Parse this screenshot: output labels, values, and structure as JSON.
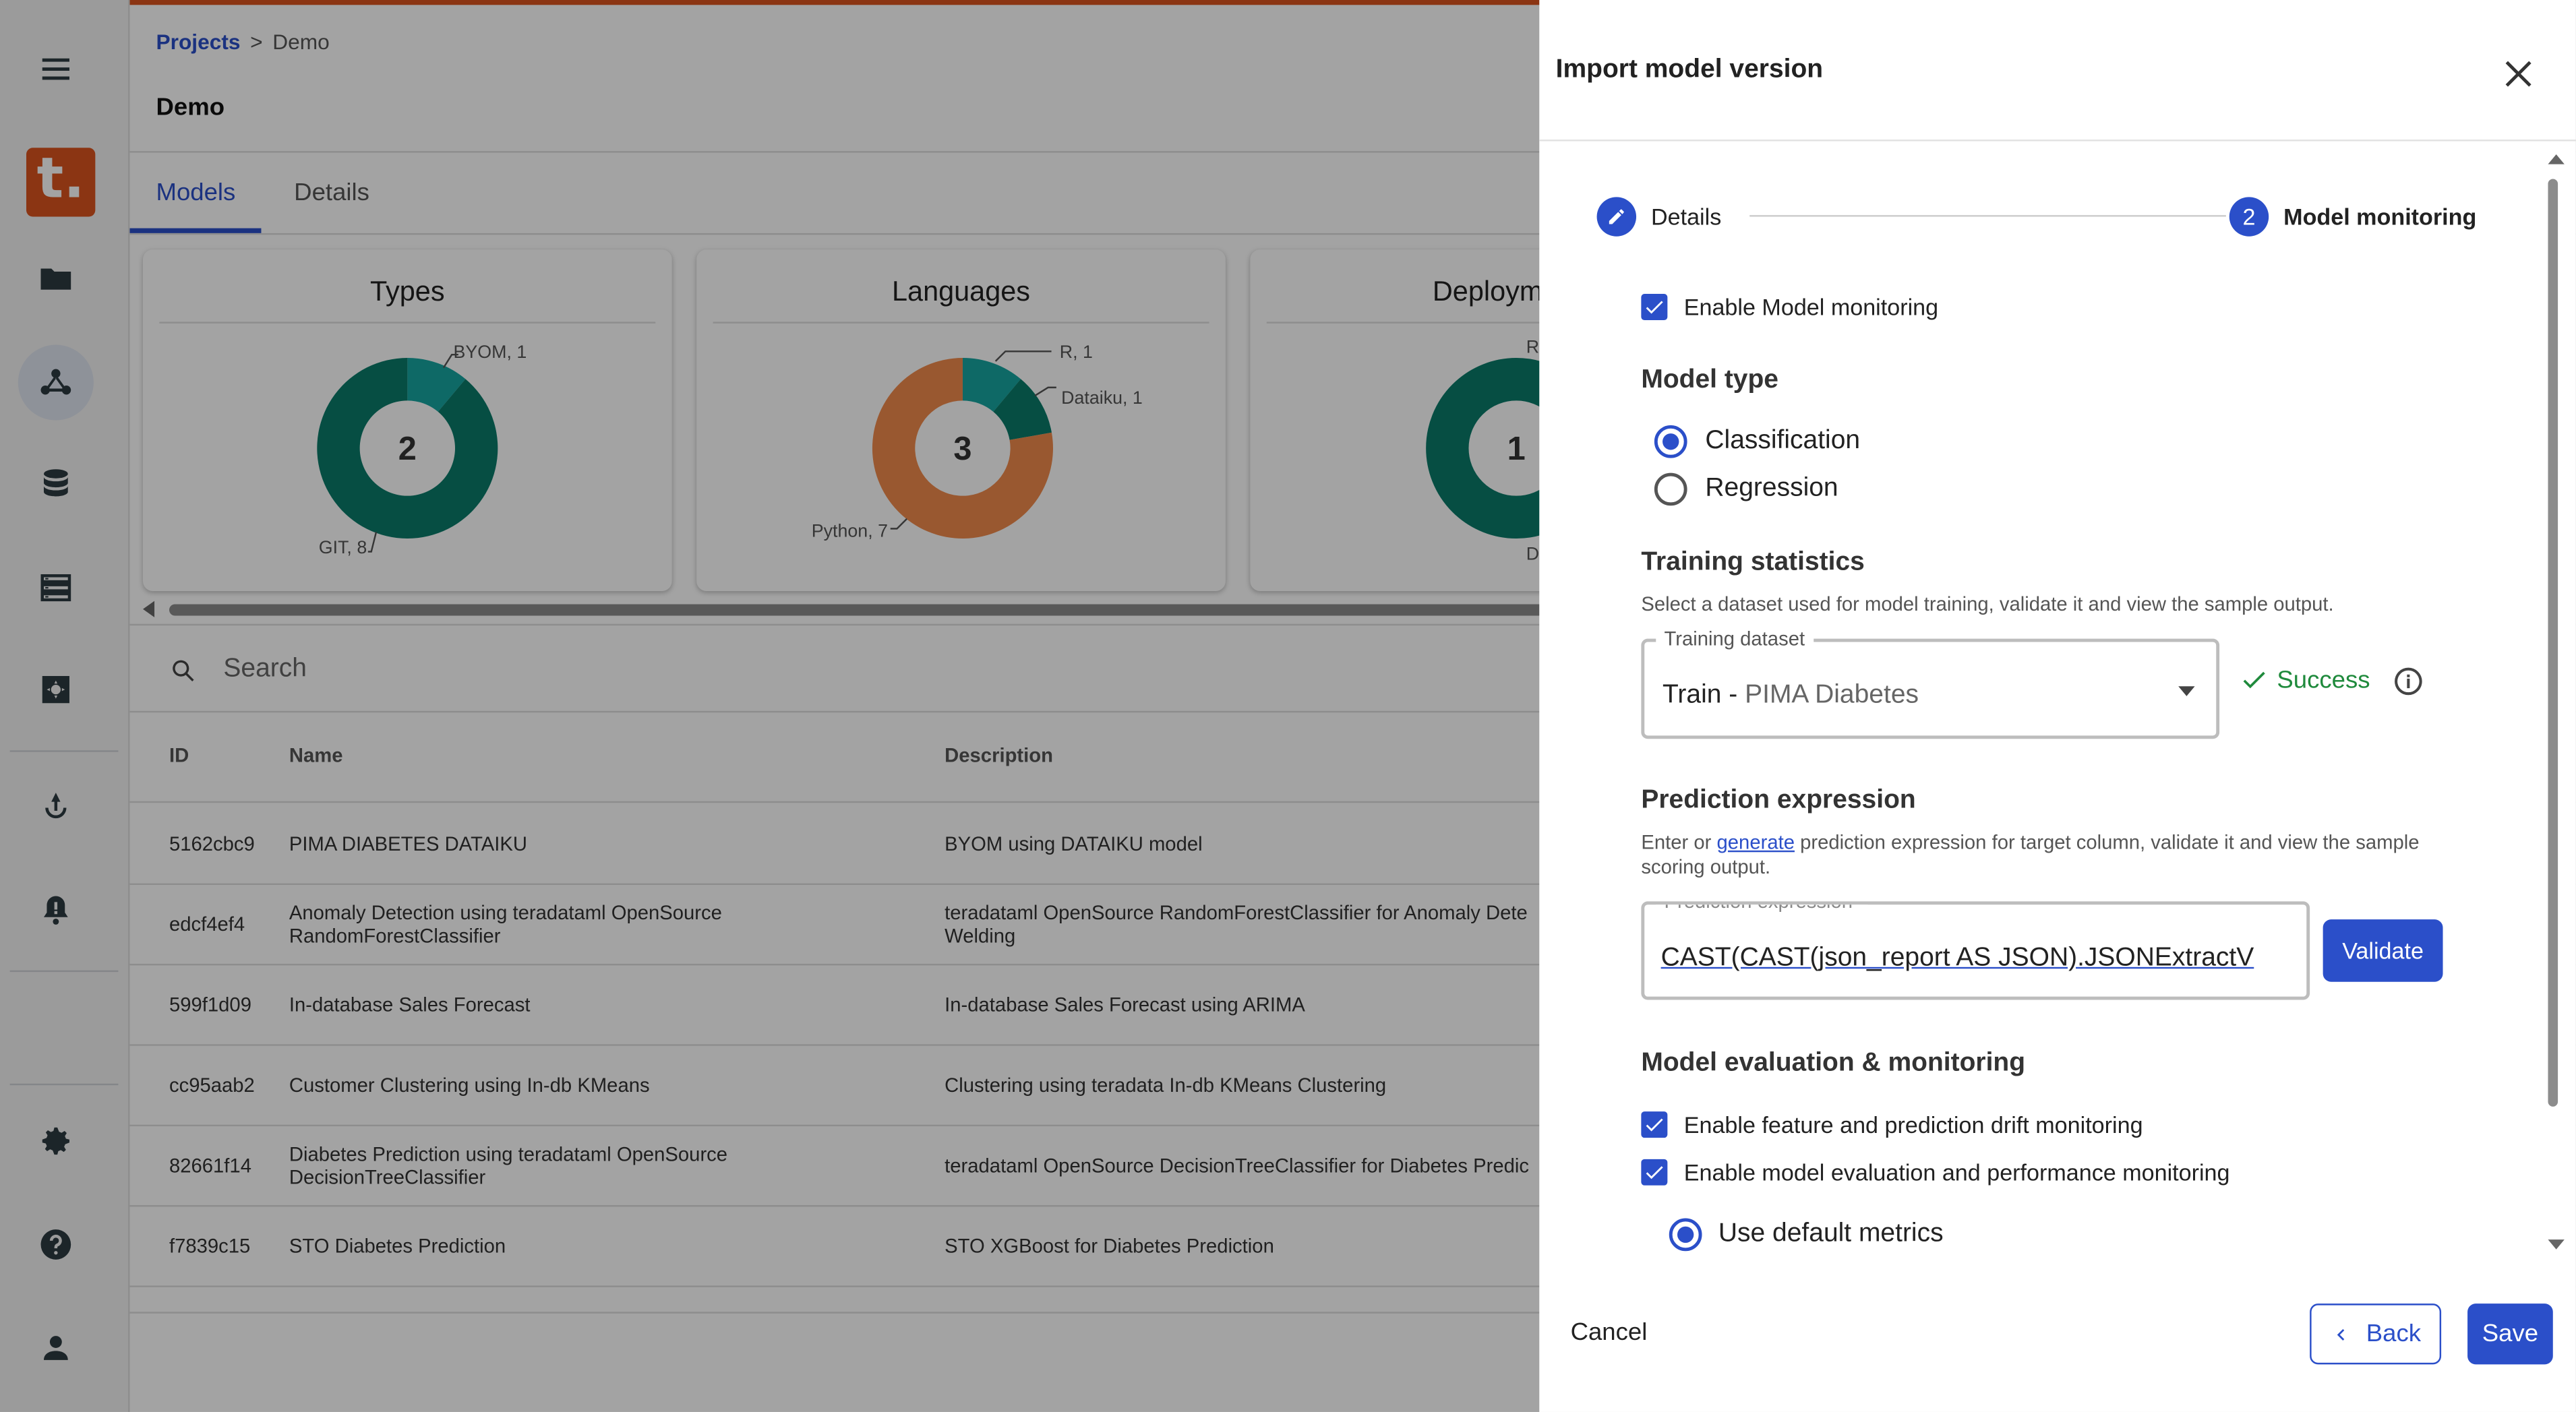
{
  "breadcrumb": {
    "projects": "Projects",
    "separator": ">",
    "current": "Demo"
  },
  "page_title": "Demo",
  "tabs": [
    {
      "label": "Models",
      "active": true
    },
    {
      "label": "Details",
      "active": false
    }
  ],
  "cards": {
    "types": {
      "title": "Types",
      "total": "2",
      "label_a": "BYOM, 1",
      "label_b": "GIT, 8"
    },
    "languages": {
      "title": "Languages",
      "total": "3",
      "label_a": "R, 1",
      "label_b": "Dataiku, 1",
      "label_c": "Python, 7"
    },
    "deployments": {
      "title": "Deployments",
      "total": "1",
      "label_a": "R",
      "label_b": "D"
    }
  },
  "chart_data": [
    {
      "type": "pie",
      "title": "Types",
      "center_label": "2",
      "categories": [
        "BYOM",
        "GIT"
      ],
      "values": [
        1,
        8
      ],
      "colors": [
        "#16a5a0",
        "#0a7a6a"
      ]
    },
    {
      "type": "pie",
      "title": "Languages",
      "center_label": "3",
      "categories": [
        "R",
        "Dataiku",
        "Python"
      ],
      "values": [
        1,
        1,
        7
      ],
      "colors": [
        "#16a5a0",
        "#0a7a6a",
        "#f08a4b"
      ]
    }
  ],
  "search": {
    "placeholder": "Search"
  },
  "table": {
    "headers": {
      "id": "ID",
      "name": "Name",
      "description": "Description"
    },
    "rows": [
      {
        "id": "5162cbc9",
        "name": "PIMA DIABETES DATAIKU",
        "description": "BYOM using DATAIKU model"
      },
      {
        "id": "edcf4ef4",
        "name": "Anomaly Detection using teradataml OpenSource RandomForestClassifier",
        "description": "teradataml OpenSource RandomForestClassifier for Anomaly Dete\nWelding"
      },
      {
        "id": "599f1d09",
        "name": "In-database Sales Forecast",
        "description": "In-database Sales Forecast using ARIMA"
      },
      {
        "id": "cc95aab2",
        "name": "Customer Clustering using In-db KMeans",
        "description": "Clustering using teradata In-db KMeans Clustering"
      },
      {
        "id": "82661f14",
        "name": "Diabetes Prediction using teradataml OpenSource DecisionTreeClassifier",
        "description": "teradataml OpenSource DecisionTreeClassifier for Diabetes Predic"
      },
      {
        "id": "f7839c15",
        "name": "STO Diabetes Prediction",
        "description": "STO XGBoost for Diabetes Prediction"
      }
    ]
  },
  "drawer": {
    "title": "Import model version",
    "steps": [
      {
        "number": "1",
        "label": "Details",
        "state": "done"
      },
      {
        "number": "2",
        "label": "Model monitoring",
        "state": "active"
      }
    ],
    "enable_monitoring": "Enable Model monitoring",
    "model_type": {
      "heading": "Model type",
      "options": [
        "Classification",
        "Regression"
      ],
      "selected": "Classification"
    },
    "training": {
      "heading": "Training statistics",
      "help": "Select a dataset used for model training, validate it and view the sample output.",
      "field_label": "Training dataset",
      "value_prefix": "Train -",
      "value_name": "PIMA Diabetes",
      "status": "Success"
    },
    "prediction": {
      "heading": "Prediction expression",
      "help_pre": "Enter or",
      "help_link": "generate",
      "help_post": "prediction expression for target column, validate it and view the sample scoring output.",
      "field_label": "Prediction expression*",
      "value": "CAST(CAST(json_report AS JSON).JSONExtractV",
      "validate": "Validate"
    },
    "evaluation": {
      "heading": "Model evaluation & monitoring",
      "drift": "Enable feature and prediction drift monitoring",
      "performance": "Enable model evaluation and performance monitoring",
      "default_metrics": "Use default metrics"
    },
    "footer": {
      "cancel": "Cancel",
      "back": "Back",
      "save": "Save"
    }
  },
  "colors": {
    "accent": "#2b4fc9",
    "brand": "#d9531e",
    "success": "#1f8a3c"
  }
}
